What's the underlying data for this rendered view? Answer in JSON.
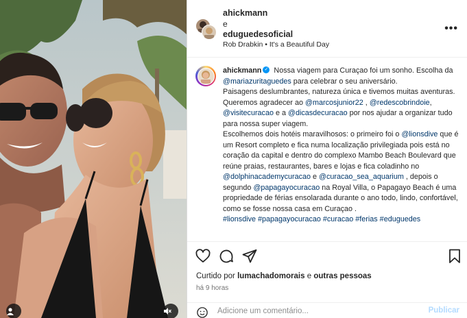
{
  "header": {
    "user1": "ahickmann",
    "and": "e",
    "user2": "eduguedesoficial",
    "audio": "Rob Drabkin • It's a Beautiful Day"
  },
  "caption": {
    "author": "ahickmann",
    "lines": [
      {
        "parts": [
          {
            "t": "Nossa viagem para Curaçao foi um sonho. Escolha da "
          },
          {
            "t": "@mariazuritaguedes",
            "mention": true
          },
          {
            "t": " para celebrar o seu aniversário."
          }
        ]
      },
      {
        "parts": [
          {
            "t": "Paisagens deslumbrantes, natureza única e tivemos muitas aventuras."
          }
        ]
      },
      {
        "parts": [
          {
            "t": "Queremos agradecer ao "
          },
          {
            "t": "@marcosjunior22",
            "mention": true
          },
          {
            "t": " , "
          },
          {
            "t": "@redescobrindoie",
            "mention": true
          },
          {
            "t": ", "
          },
          {
            "t": "@visitecuracao",
            "mention": true
          },
          {
            "t": " e a "
          },
          {
            "t": "@dicasdecuracao",
            "mention": true
          },
          {
            "t": " por nos ajudar a organizar tudo para nossa super viagem."
          }
        ]
      },
      {
        "parts": [
          {
            "t": "Escolhemos dois hotéis maravilhosos: o primeiro foi o "
          },
          {
            "t": "@lionsdive",
            "mention": true
          },
          {
            "t": " que é um Resort completo e fica numa localização privilegiada pois está no coração da capital e dentro do complexo Mambo Beach Boulevard que reúne praias, restaurantes, bares e lojas e fica coladinho no "
          },
          {
            "t": "@dolphinacademycuracao",
            "mention": true
          },
          {
            "t": " e "
          },
          {
            "t": "@curacao_sea_aquarium",
            "mention": true
          },
          {
            "t": " , depois o segundo "
          },
          {
            "t": "@papagayocuracao",
            "mention": true
          },
          {
            "t": " na Royal Villa, o Papagayo Beach é uma propriedade de férias ensolarada durante o ano todo, lindo, confortável, como se fosse nossa casa em Curaçao ."
          }
        ]
      },
      {
        "parts": [
          {
            "t": "#lionsdive #papagayocuracao #curacao #ferias #eduguedes",
            "mention": true
          }
        ]
      }
    ]
  },
  "actions": {
    "liked_prefix": "Curtido por ",
    "liked_user": "lumachadomorais",
    "liked_suffix": " e ",
    "liked_others": "outras pessoas",
    "time": "há 9 horas"
  },
  "comment": {
    "placeholder": "Adicione um comentário...",
    "publish": "Publicar"
  },
  "colors": {
    "mention": "#00376b",
    "verified": "#0095f6",
    "publish_disabled": "#b3dbff"
  },
  "icons": [
    "heart-icon",
    "comment-icon",
    "share-icon",
    "bookmark-icon",
    "more-icon",
    "emoji-icon",
    "tag-icon",
    "mute-icon",
    "verified-icon"
  ]
}
